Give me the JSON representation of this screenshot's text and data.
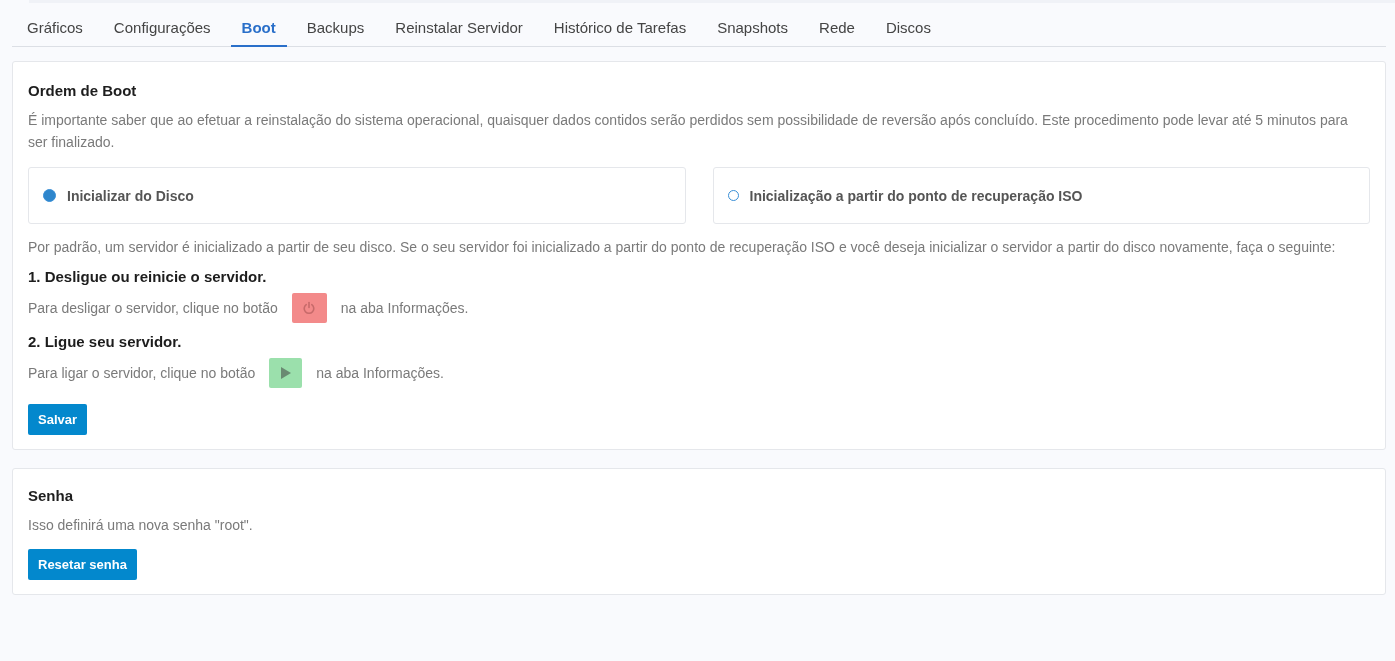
{
  "tabs": [
    {
      "label": "Gráficos",
      "selected": false
    },
    {
      "label": "Configurações",
      "selected": false
    },
    {
      "label": "Boot",
      "selected": true
    },
    {
      "label": "Backups",
      "selected": false
    },
    {
      "label": "Reinstalar Servidor",
      "selected": false
    },
    {
      "label": "Histórico de Tarefas",
      "selected": false
    },
    {
      "label": "Snapshots",
      "selected": false
    },
    {
      "label": "Rede",
      "selected": false
    },
    {
      "label": "Discos",
      "selected": false
    }
  ],
  "boot_order": {
    "title": "Ordem de Boot",
    "warning": "É importante saber que ao efetuar a reinstalação do sistema operacional, quaisquer dados contidos serão perdidos sem possibilidade de reversão após concluído. Este procedimento pode levar até 5 minutos para ser finalizado.",
    "options": [
      {
        "label": "Inicializar do Disco",
        "selected": true
      },
      {
        "label": "Inicialização a partir do ponto de recuperação ISO",
        "selected": false
      }
    ],
    "description": "Por padrão, um servidor é inicializado a partir de seu disco. Se o seu servidor foi inicializado a partir do ponto de recuperação ISO e você deseja inicializar o servidor a partir do disco novamente, faça o seguinte:",
    "steps": [
      {
        "heading": "1. Desligue ou reinicie o servidor.",
        "text_before": "Para desligar o servidor, clique no botão",
        "kind": "power",
        "text_after": "na aba Informações."
      },
      {
        "heading": "2. Ligue seu servidor.",
        "text_before": "Para ligar o servidor, clique no botão",
        "kind": "play",
        "text_after": "na aba Informações."
      }
    ],
    "save_button": "Salvar"
  },
  "password": {
    "title": "Senha",
    "description": "Isso definirá uma nova senha \"root\".",
    "reset_button": "Resetar senha"
  }
}
